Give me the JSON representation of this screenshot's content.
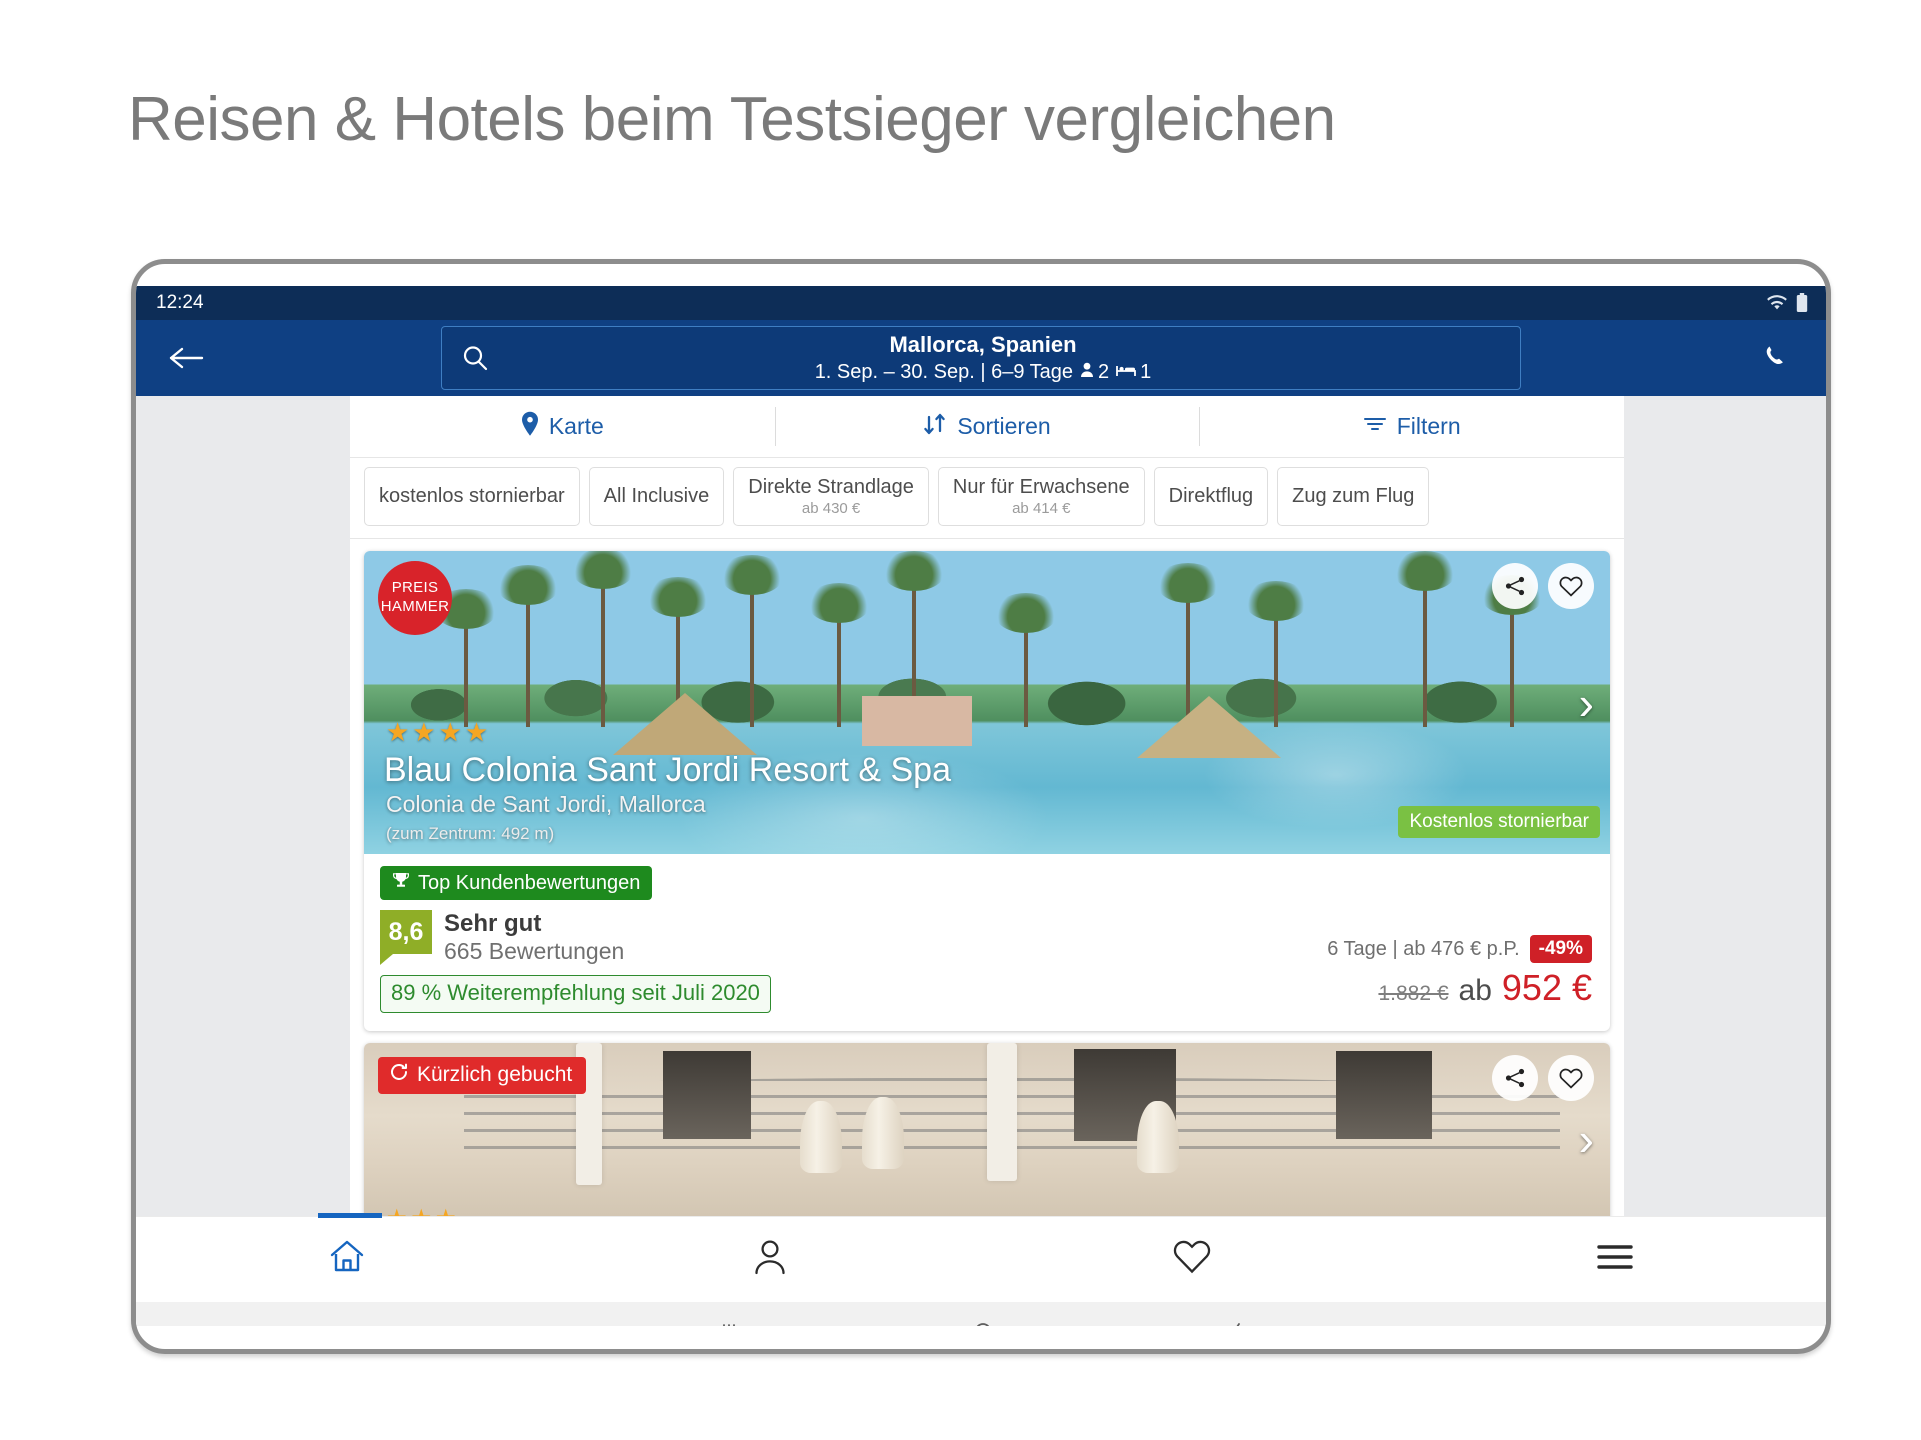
{
  "headline": "Reisen & Hotels beim Testsieger vergleichen",
  "status_bar": {
    "time": "12:24",
    "icons": [
      "wifi-icon",
      "battery-icon"
    ]
  },
  "app_bar": {
    "back_icon": "back-arrow-icon",
    "phone_icon": "phone-icon",
    "search": {
      "icon": "search-icon",
      "destination": "Mallorca, Spanien",
      "dates": "1. Sep. – 30. Sep. | 6–9 Tage",
      "guests_icon": "person-icon",
      "guests": "2",
      "rooms_icon": "bed-icon",
      "rooms": "1"
    }
  },
  "actions": [
    {
      "label": "Karte",
      "icon": "map-pin-icon"
    },
    {
      "label": "Sortieren",
      "icon": "sort-icon"
    },
    {
      "label": "Filtern",
      "icon": "filter-icon"
    }
  ],
  "filter_chips": [
    {
      "label": "kostenlos stornierbar",
      "sub": ""
    },
    {
      "label": "All Inclusive",
      "sub": ""
    },
    {
      "label": "Direkte Strandlage",
      "sub": "ab 430 €"
    },
    {
      "label": "Nur für Erwachsene",
      "sub": "ab 414 €"
    },
    {
      "label": "Direktflug",
      "sub": ""
    },
    {
      "label": "Zug zum Flug",
      "sub": ""
    }
  ],
  "cards": [
    {
      "promo_badge_line1": "PREIS",
      "promo_badge_line2": "HAMMER",
      "share_icon": "share-icon",
      "favorite_icon": "heart-icon",
      "next_icon": "chevron-right-icon",
      "stars": "★★★★",
      "name": "Blau Colonia Sant Jordi Resort & Spa",
      "location": "Colonia de Sant Jordi, Mallorca",
      "distance": "(zum Zentrum: 492 m)",
      "cancel_badge": "Kostenlos stornierbar",
      "top_badge": "Top Kundenbewertungen",
      "top_badge_icon": "trophy-icon",
      "score": "8,6",
      "rating_word": "Sehr gut",
      "reviews": "665 Bewertungen",
      "recommend": "89 % Weiterempfehlung seit Juli 2020",
      "price_detail": "6 Tage | ab 476 € p.P.",
      "discount": "-49%",
      "old_price": "1.882 €",
      "ab_label": "ab",
      "price": "952 €"
    },
    {
      "recent_badge": "Kürzlich gebucht",
      "recent_icon": "refresh-icon",
      "share_icon": "share-icon",
      "favorite_icon": "heart-icon",
      "next_icon": "chevron-right-icon",
      "stars": "★★★"
    }
  ],
  "bottom_nav": [
    {
      "name": "home",
      "icon": "home-icon",
      "active": true
    },
    {
      "name": "account",
      "icon": "person-icon",
      "active": false
    },
    {
      "name": "favorites",
      "icon": "heart-icon",
      "active": false
    },
    {
      "name": "menu",
      "icon": "hamburger-menu-icon",
      "active": false
    }
  ],
  "system_bar": [
    {
      "name": "recents",
      "icon": "recents-icon"
    },
    {
      "name": "home",
      "icon": "circle-home-icon"
    },
    {
      "name": "back",
      "icon": "back-chevron-icon"
    }
  ],
  "colors": {
    "brand_dark": "#0d2d57",
    "brand": "#0f4083",
    "link": "#1d5da8",
    "green": "#7ac143",
    "red": "#cf2027",
    "score_green": "#8fae27"
  }
}
